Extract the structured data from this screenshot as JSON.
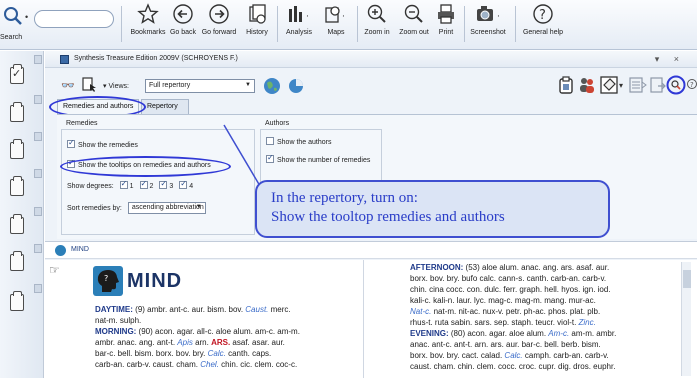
{
  "toolbar": {
    "search_caption": "Search",
    "buttons": [
      {
        "label": "Bookmarks",
        "icon": "star-icon"
      },
      {
        "label": "Go back",
        "icon": "arrow-left-icon"
      },
      {
        "label": "Go forward",
        "icon": "arrow-right-icon"
      },
      {
        "label": "History",
        "icon": "history-icon"
      },
      {
        "label": "Analysis",
        "icon": "analysis-icon"
      },
      {
        "label": "Maps",
        "icon": "maps-icon"
      },
      {
        "label": "Zoom in",
        "icon": "zoom-in-icon"
      },
      {
        "label": "Zoom out",
        "icon": "zoom-out-icon"
      },
      {
        "label": "Print",
        "icon": "print-icon"
      },
      {
        "label": "Screenshot",
        "icon": "camera-icon"
      },
      {
        "label": "General help",
        "icon": "help-icon"
      }
    ]
  },
  "panel": {
    "title": "Synthesis Treasure Edition 2009V (SCHROYENS F.)",
    "views_label": "Views:",
    "views_value": "Full repertory",
    "tabs": [
      "Remedies and authors",
      "Repertory"
    ]
  },
  "remedies": {
    "group_title": "Remedies",
    "show_remedies": "Show the remedies",
    "show_tooltips": "Show the tooltips on remedies and authors",
    "degrees_label": "Show degrees:",
    "degrees": [
      "1",
      "2",
      "3",
      "4"
    ],
    "sort_label": "Sort remedies by:",
    "sort_value": "ascending abbreviation"
  },
  "authors": {
    "group_title": "Authors",
    "show_authors": "Show the authors",
    "show_number": "Show the number of remedies"
  },
  "callout": {
    "line1": "In the repertory, turn on:",
    "line2": "Show the tooltop remedies and authors"
  },
  "mind_bar": {
    "label": "MIND"
  },
  "content": {
    "title": "MIND",
    "left": {
      "daytime_head": "DAYTIME:",
      "daytime_text": " (9) ambr. ant-c. aur. bism. bov. ",
      "daytime_rem": "Caust.",
      "daytime_text2": " merc.",
      "daytime_line2": "nat-m. sulph.",
      "morning_head": "MORNING:",
      "morning_text": " (90) acon. agar. all-c. aloe alum. am-c. am-m.",
      "morning_line2a": "ambr. anac. ang. ant-t. ",
      "morning_apis": "Apis",
      "morning_line2b": " arn. ",
      "morning_ars": "ARS.",
      "morning_line2c": " asaf. asar. aur.",
      "morning_line3a": "bar-c. bell. bism. borx. bov. bry. ",
      "morning_calc": "Calc.",
      "morning_line3b": " canth. caps.",
      "morning_line4a": "carb-an. carb-v. caust. cham. ",
      "morning_chel": "Chel.",
      "morning_line4b": " chin. cic. clem. coc-c."
    },
    "right": {
      "afternoon_head": "AFTERNOON:",
      "afternoon_text": " (53) aloe alum. anac. ang. ars. asaf. aur.",
      "line2a": "borx. bov. bry. bufo calc. cann-s. canth. carb-an. carb-v.",
      "line3a": "chin. cina cocc. con. dulc. ferr. graph. hell. hyos. ign. iod.",
      "line4a": "kali-c. kali-n. laur. lyc. mag-c. mag-m. mang. mur-ac.",
      "line5_rem": "Nat-c.",
      "line5a": " nat-m. nit-ac. nux-v. petr. ph-ac. phos. plat. plb.",
      "line6a": "rhus-t. ruta sabin. sars. sep. staph. teucr. viol-t. ",
      "line6_rem": "Zinc.",
      "evening_head": "EVENING:",
      "evening_text": " (80) acon. agar. aloe alum. ",
      "evening_rem": "Am-c.",
      "evening_text2": " am-m. ambr.",
      "line8a": "anac. ant-c. ant-t. arn. ars. aur. bar-c. bell. berb. bism.",
      "line9a": "borx. bov. bry. cact. calad. ",
      "line9_rem": "Calc.",
      "line9b": " camph. carb-an. carb-v.",
      "line10a": "caust. cham. chin. clem. cocc. croc. cupr. dig. dros. euphr."
    }
  },
  "colors": {
    "highlight": "#2f38d6",
    "callout_text": "#2a3dc8",
    "section_head": "#1f3a8a",
    "remedy_italic": "#3b6cc9",
    "remedy_bold": "#c1121f"
  }
}
